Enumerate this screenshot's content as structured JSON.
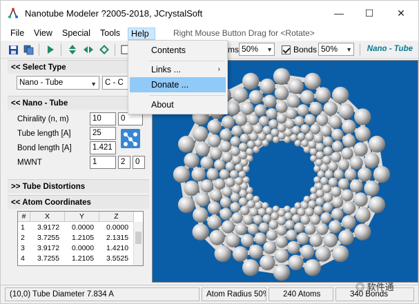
{
  "window": {
    "title": "Nanotube Modeler ?2005-2018, JCrystalSoft",
    "minimize": "—",
    "maximize": "☐",
    "close": "✕"
  },
  "menubar": {
    "items": [
      "File",
      "View",
      "Special",
      "Tools",
      "Help"
    ],
    "hint": "Right Mouse Button Drag for <Rotate>"
  },
  "help_menu": {
    "items": [
      {
        "label": "Contents"
      },
      {
        "label": "Links ...",
        "submenu_arrow": "›"
      },
      {
        "label": "Donate ..."
      },
      {
        "label": "About"
      }
    ]
  },
  "toolbar": {
    "atoms_label": "ms",
    "atoms_percent": "50%",
    "bonds_label": "Bonds",
    "bonds_percent": "50%",
    "mode_label": "Nano - Tube"
  },
  "left_panel": {
    "select_type": {
      "header": "<<  Select Type",
      "type_value": "Nano - Tube",
      "element_value": "C - C"
    },
    "nano_tube": {
      "header": "<<  Nano - Tube",
      "chirality_label": "Chirality  (n, m)",
      "chirality_n": "10",
      "chirality_m": "0",
      "tube_length_label": "Tube length [A]",
      "tube_length": "25",
      "bond_length_label": "Bond length [A]",
      "bond_length": "1.421",
      "mwnt_label": "MWNT",
      "mwnt_1": "1",
      "mwnt_2": "2",
      "mwnt_3": "0"
    },
    "tube_distortions": {
      "header": ">>  Tube Distortions"
    },
    "atom_coordinates": {
      "header": "<<  Atom Coordinates",
      "columns": [
        "#",
        "X",
        "Y",
        "Z"
      ],
      "rows": [
        [
          "1",
          "3.9172",
          "0.0000",
          "0.0000"
        ],
        [
          "2",
          "3.7255",
          "1.2105",
          "2.1315"
        ],
        [
          "3",
          "3.9172",
          "0.0000",
          "1.4210"
        ],
        [
          "4",
          "3.7255",
          "1.2105",
          "3.5525"
        ]
      ]
    }
  },
  "status": {
    "diameter": "(10,0) Tube Diameter 7.834 A",
    "atom_radius": "Atom Radius 50%",
    "atoms": "240 Atoms",
    "bonds": "340 Bonds"
  },
  "watermark": "软件通",
  "colors": {
    "viewport_bg": "#0a5ea8",
    "menu_highlight": "#91c9f7",
    "brand_text": "#0a7a8f"
  }
}
